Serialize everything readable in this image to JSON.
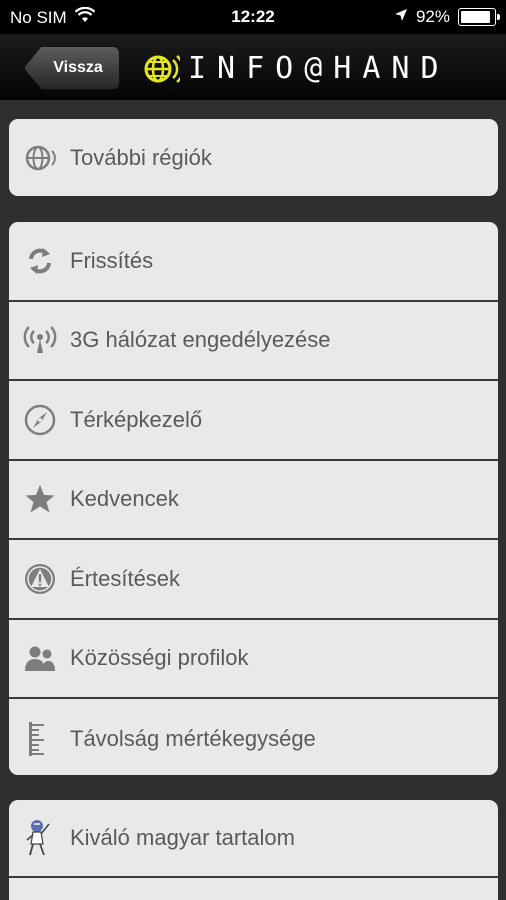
{
  "status_bar": {
    "carrier": "No SIM",
    "time": "12:22",
    "battery_percent": "92%",
    "battery_level": 0.92
  },
  "nav": {
    "back_label": "Vissza",
    "logo_text": "INFO@HAND",
    "logo_color": "#e6e61e"
  },
  "groups": [
    {
      "items": [
        {
          "label": "További régiók",
          "icon": "globe-icon"
        }
      ]
    },
    {
      "items": [
        {
          "label": "Frissítés",
          "icon": "refresh-icon"
        },
        {
          "label": "3G hálózat engedélyezése",
          "icon": "signal-tower-icon"
        },
        {
          "label": "Térképkezelő",
          "icon": "compass-icon"
        },
        {
          "label": "Kedvencek",
          "icon": "star-icon"
        },
        {
          "label": "Értesítések",
          "icon": "warning-icon"
        },
        {
          "label": "Közösségi profilok",
          "icon": "people-icon"
        },
        {
          "label": "Távolság mértékegysége",
          "icon": "ruler-icon"
        }
      ]
    },
    {
      "items": [
        {
          "label": "Kiváló magyar tartalom",
          "icon": "mascot-icon"
        }
      ]
    }
  ]
}
